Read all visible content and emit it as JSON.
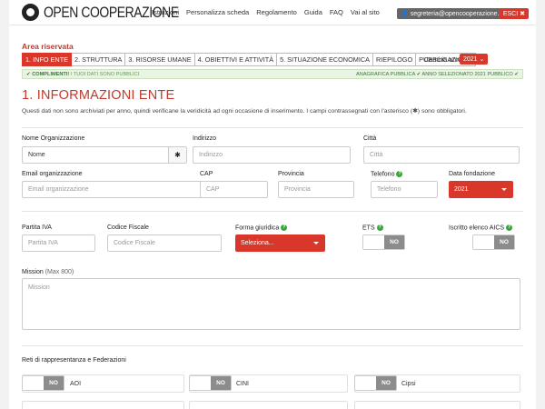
{
  "header": {
    "logo_text": "OPEN COOPERAZIONE",
    "nav": [
      "Istruzioni",
      "Personalizza scheda",
      "Regolamento",
      "Guida",
      "FAQ",
      "Vai al sito"
    ],
    "user_email": "segreteria@opencooperazione.it",
    "exit_label": "ESCI"
  },
  "area": {
    "title": "Area riservata",
    "steps": [
      "1. INFO ENTE",
      "2. STRUTTURA",
      "3. RISORSE UMANE",
      "4. OBIETTIVI E ATTIVITÀ",
      "5. SITUAZIONE ECONOMICA",
      "RIEPILOGO",
      "PUBBLICAZIONE"
    ],
    "active_step": 0,
    "year_label": "Cambia anno:",
    "year_value": "2021"
  },
  "alert": {
    "left_bold": "COMPLIMENTI!",
    "left_text": "I TUOI DATI SONO PUBBLICI",
    "right_1": "ANAGRAFICA PUBBLICA",
    "right_2": "ANNO SELEZIONATO 2021 PUBBLICO"
  },
  "section": {
    "title": "1. INFORMAZIONI ENTE",
    "intro": "Questi dati non sono archiviati per anno, quindi verificane la veridicità ad ogni occasione di inserimento. I campi contrassegnati con l'asterisco (✱) sono obbligatori."
  },
  "form": {
    "org_name_label": "Nome Organizzazione",
    "org_name_value": "Nome",
    "address_label": "Indirizzo",
    "address_placeholder": "Indirizzo",
    "city_label": "Città",
    "city_placeholder": "Città",
    "email_label": "Email organizzazione",
    "email_placeholder": "Email organizzazione",
    "cap_label": "CAP",
    "cap_placeholder": "CAP",
    "province_label": "Provincia",
    "province_placeholder": "Provincia",
    "phone_label": "Telefono",
    "phone_placeholder": "Telefono",
    "founded_label": "Data fondazione",
    "founded_value": "2021",
    "vat_label": "Partita IVA",
    "vat_placeholder": "Partita IVA",
    "fiscal_label": "Codice Fiscale",
    "fiscal_placeholder": "Codice Fiscale",
    "legal_form_label": "Forma giuridica",
    "legal_form_value": "Seleziona...",
    "ets_label": "ETS",
    "aics_label": "Iscritto elenco AICS",
    "mission_label": "Mission",
    "mission_hint": "(Max 800)",
    "mission_placeholder": "Mission",
    "toggle_no": "NO"
  },
  "networks": {
    "title": "Reti di rappresentanza e Federazioni",
    "items": [
      "AOI",
      "CINI",
      "Cipsi"
    ]
  }
}
